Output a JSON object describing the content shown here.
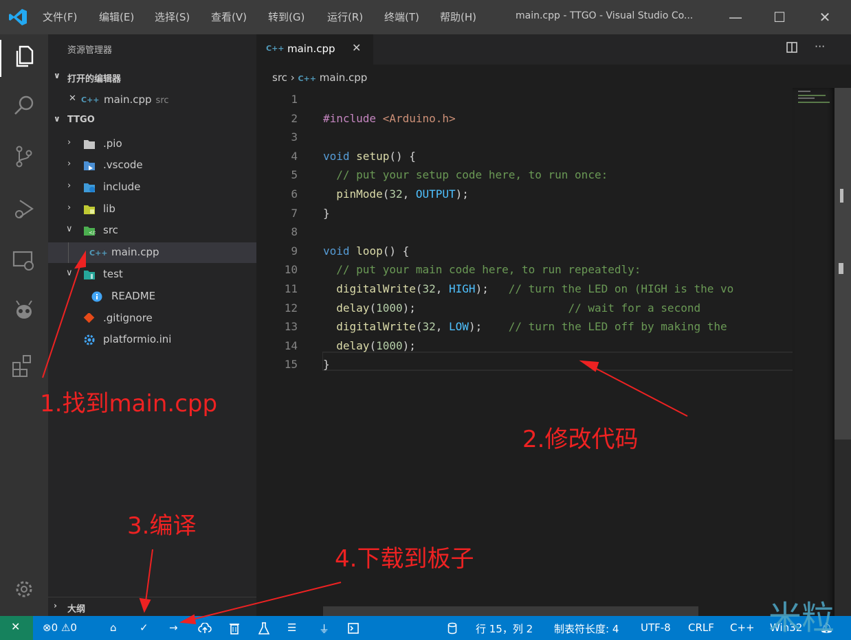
{
  "titlebar": {
    "menu": [
      "文件(F)",
      "编辑(E)",
      "选择(S)",
      "查看(V)",
      "转到(G)",
      "运行(R)",
      "终端(T)",
      "帮助(H)"
    ],
    "window_title": "main.cpp - TTGO - Visual Studio Co...",
    "minimize": "—",
    "maximize": "☐",
    "close": "✕"
  },
  "sidebar": {
    "title": "资源管理器",
    "open_editors_header": "打开的编辑器",
    "open_editor_close": "✕",
    "open_editor_icon": "C++",
    "open_editor_name": "main.cpp",
    "open_editor_desc": "src",
    "project_header": "TTGO",
    "items": [
      {
        "name": ".pio",
        "icon": "folder-icon"
      },
      {
        "name": ".vscode",
        "icon": "folder-vscode-icon"
      },
      {
        "name": "include",
        "icon": "folder-include-icon"
      },
      {
        "name": "lib",
        "icon": "folder-lib-icon"
      },
      {
        "name": "src",
        "icon": "folder-src-icon"
      },
      {
        "name": "main.cpp",
        "icon": "cpp-file-icon"
      },
      {
        "name": "test",
        "icon": "folder-test-icon"
      },
      {
        "name": "README",
        "icon": "info-icon"
      },
      {
        "name": ".gitignore",
        "icon": "git-icon"
      },
      {
        "name": "platformio.ini",
        "icon": "gear-file-icon"
      }
    ],
    "outline_header": "大纲"
  },
  "editor": {
    "tab_label": "main.cpp",
    "tab_icon": "C++",
    "breadcrumb_folder": "src",
    "breadcrumb_file": "main.cpp",
    "lines": [
      "",
      "#include <Arduino.h>",
      "",
      "void setup() {",
      "  // put your setup code here, to run once:",
      "  pinMode(32, OUTPUT);",
      "}",
      "",
      "void loop() {",
      "  // put your main code here, to run repeatedly:",
      "  digitalWrite(32, HIGH);   // turn the LED on (HIGH is the vo",
      "  delay(1000);                       // wait for a second",
      "  digitalWrite(32, LOW);    // turn the LED off by making the",
      "  delay(1000);",
      "}"
    ]
  },
  "statusbar": {
    "errors": "⊗0",
    "warnings": "⚠0",
    "position": "行 15，列 2",
    "tab_size": "制表符长度: 4",
    "encoding": "UTF-8",
    "eol": "CRLF",
    "language": "C++",
    "platform": "Win32"
  },
  "annotations": {
    "step1": "1.找到main.cpp",
    "step2": "2.修改代码",
    "step3": "3.编译",
    "step4": "4.下载到板子",
    "color": "#ee2222"
  },
  "watermark": "米粒",
  "colors": {
    "statusbar": "#007acc",
    "activitybar": "#333333",
    "sidebar": "#252526",
    "editor": "#1e1e1e"
  }
}
